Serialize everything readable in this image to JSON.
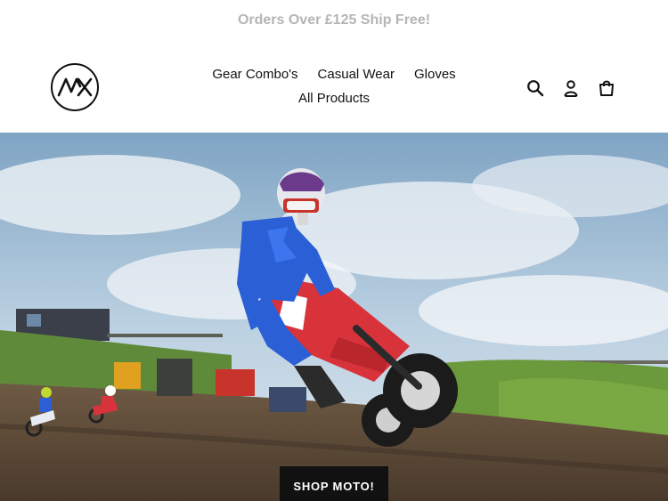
{
  "announcement": {
    "text": "Orders Over £125 Ship Free!"
  },
  "logo": {
    "alt_name": "MX logo"
  },
  "nav": {
    "row1": [
      {
        "label": "Gear Combo's"
      },
      {
        "label": "Casual Wear"
      },
      {
        "label": "Gloves"
      }
    ],
    "row2": [
      {
        "label": "All Products"
      }
    ]
  },
  "header_icons": [
    "search-icon",
    "account-icon",
    "cart-icon"
  ],
  "hero": {
    "button_label": "SHOP MOTO!"
  },
  "colors": {
    "announcement_text": "#b5b5b5",
    "button_bg": "#111111",
    "button_text": "#ffffff",
    "rider_suit": "#2a5fd6",
    "bike": "#d8333a"
  }
}
